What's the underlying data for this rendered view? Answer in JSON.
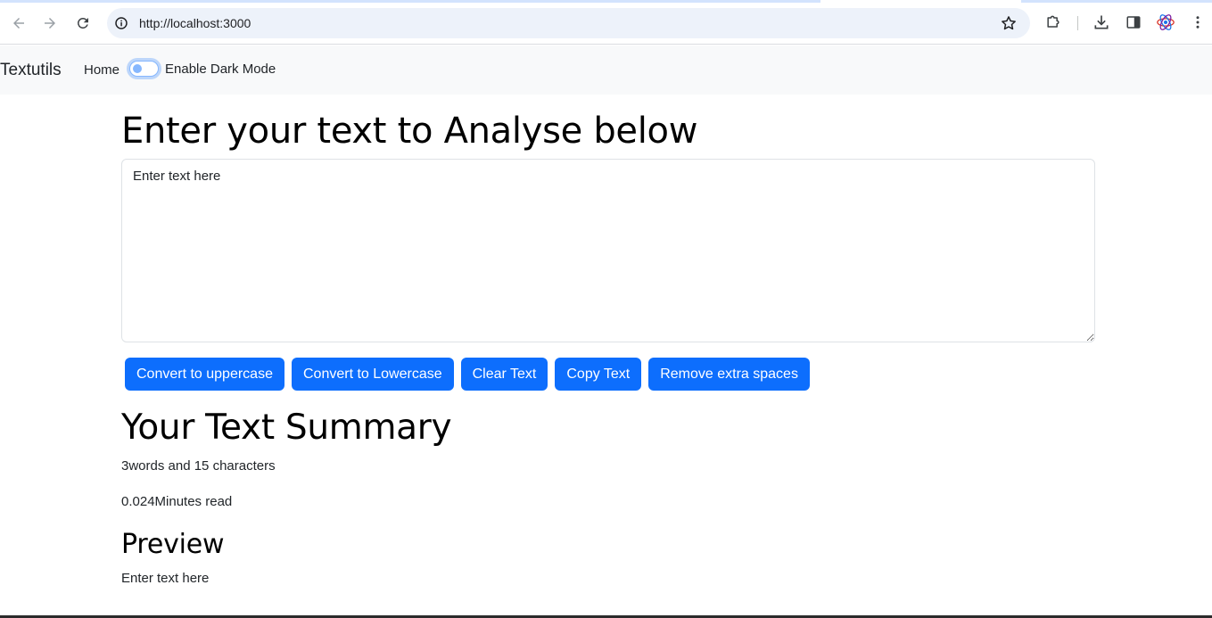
{
  "browser": {
    "url": "http://localhost:3000",
    "icons": [
      "back-icon",
      "forward-icon",
      "reload-icon",
      "site-info-icon",
      "bookmark-star-icon",
      "extensions-icon",
      "downloads-icon",
      "side-panel-icon",
      "profile-icon",
      "menu-icon"
    ]
  },
  "navbar": {
    "brand": "Textutils",
    "home_label": "Home",
    "dark_mode_label": "Enable Dark Mode",
    "dark_mode_enabled": false
  },
  "main": {
    "heading": "Enter your text to Analyse below",
    "textarea_value": "Enter text here",
    "buttons": [
      "Convert to uppercase",
      "Convert to Lowercase",
      "Clear Text",
      "Copy Text",
      "Remove extra spaces"
    ]
  },
  "summary": {
    "heading": "Your Text Summary",
    "words_chars": "3words and 15 characters",
    "read_time": "0.024Minutes read"
  },
  "preview": {
    "heading": "Preview",
    "text": "Enter text here"
  },
  "colors": {
    "primary": "#0d6efd",
    "navbar_bg": "#f8f9fa",
    "omnibox_bg": "#edf2fa"
  }
}
